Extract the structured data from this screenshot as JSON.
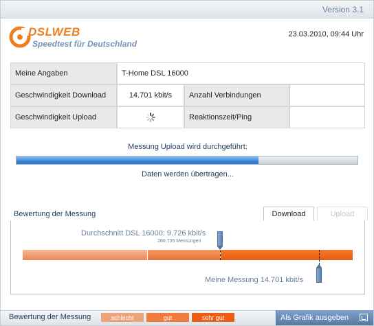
{
  "header": {
    "version": "Version 3.1",
    "logo_word": "DSLWEB",
    "logo_tagline": "Speedtest für Deutschland",
    "datetime": "23.03.2010, 09:44 Uhr"
  },
  "info": {
    "my_details_label": "Meine Angaben",
    "my_details_value": "T-Home DSL 16000",
    "download_label": "Geschwindigkeit Download",
    "download_value": "14.701 kbit/s",
    "connections_label": "Anzahl Verbindungen",
    "connections_value": "",
    "upload_label": "Geschwindigkeit Upload",
    "ping_label": "Reaktionszeit/Ping",
    "ping_value": ""
  },
  "progress": {
    "title": "Messung Upload wird durchgeführt:",
    "fraction": 0.71,
    "status": "Daten werden übertragen..."
  },
  "rating": {
    "panel_title": "Bewertung der Messung",
    "tabs": [
      {
        "label": "Download",
        "active": true
      },
      {
        "label": "Upload",
        "active": false
      }
    ],
    "average_label": "Durchschnitt DSL 16000: 9.726 kbit/s",
    "average_count": "280.735 Messungen",
    "my_measurement_label": "Meine Messung 14.701 kbit/s",
    "scale": {
      "segments": [
        0.38,
        0.22,
        0.4
      ],
      "average_position": 0.598,
      "mine_position": 0.898
    }
  },
  "footer": {
    "legend_title": "Bewertung der Messung",
    "legend": [
      "schlecht",
      "gut",
      "sehr gut"
    ],
    "export_label": "Als Grafik ausgeben"
  },
  "colors": {
    "accent_orange": "#ee7d1e",
    "progress_blue": "#3a86d6",
    "bad": "#eda27a",
    "good": "#f07b3d",
    "very_good": "#ef5c15"
  },
  "icons": {
    "upload_status": "spinner-icon",
    "export": "export-icon"
  }
}
